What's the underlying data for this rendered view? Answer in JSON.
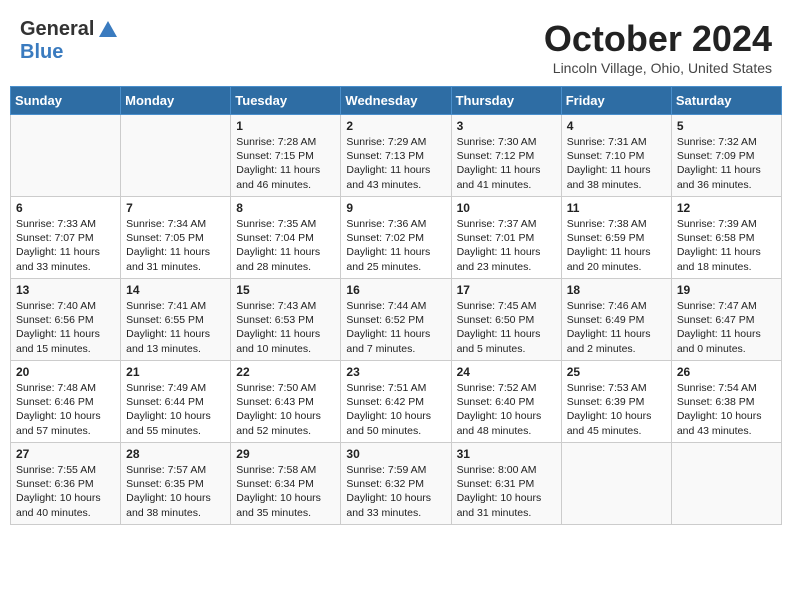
{
  "header": {
    "logo_line1": "General",
    "logo_line2": "Blue",
    "month": "October 2024",
    "location": "Lincoln Village, Ohio, United States"
  },
  "weekdays": [
    "Sunday",
    "Monday",
    "Tuesday",
    "Wednesday",
    "Thursday",
    "Friday",
    "Saturday"
  ],
  "weeks": [
    [
      {
        "day": "",
        "text": ""
      },
      {
        "day": "",
        "text": ""
      },
      {
        "day": "1",
        "text": "Sunrise: 7:28 AM\nSunset: 7:15 PM\nDaylight: 11 hours\nand 46 minutes."
      },
      {
        "day": "2",
        "text": "Sunrise: 7:29 AM\nSunset: 7:13 PM\nDaylight: 11 hours\nand 43 minutes."
      },
      {
        "day": "3",
        "text": "Sunrise: 7:30 AM\nSunset: 7:12 PM\nDaylight: 11 hours\nand 41 minutes."
      },
      {
        "day": "4",
        "text": "Sunrise: 7:31 AM\nSunset: 7:10 PM\nDaylight: 11 hours\nand 38 minutes."
      },
      {
        "day": "5",
        "text": "Sunrise: 7:32 AM\nSunset: 7:09 PM\nDaylight: 11 hours\nand 36 minutes."
      }
    ],
    [
      {
        "day": "6",
        "text": "Sunrise: 7:33 AM\nSunset: 7:07 PM\nDaylight: 11 hours\nand 33 minutes."
      },
      {
        "day": "7",
        "text": "Sunrise: 7:34 AM\nSunset: 7:05 PM\nDaylight: 11 hours\nand 31 minutes."
      },
      {
        "day": "8",
        "text": "Sunrise: 7:35 AM\nSunset: 7:04 PM\nDaylight: 11 hours\nand 28 minutes."
      },
      {
        "day": "9",
        "text": "Sunrise: 7:36 AM\nSunset: 7:02 PM\nDaylight: 11 hours\nand 25 minutes."
      },
      {
        "day": "10",
        "text": "Sunrise: 7:37 AM\nSunset: 7:01 PM\nDaylight: 11 hours\nand 23 minutes."
      },
      {
        "day": "11",
        "text": "Sunrise: 7:38 AM\nSunset: 6:59 PM\nDaylight: 11 hours\nand 20 minutes."
      },
      {
        "day": "12",
        "text": "Sunrise: 7:39 AM\nSunset: 6:58 PM\nDaylight: 11 hours\nand 18 minutes."
      }
    ],
    [
      {
        "day": "13",
        "text": "Sunrise: 7:40 AM\nSunset: 6:56 PM\nDaylight: 11 hours\nand 15 minutes."
      },
      {
        "day": "14",
        "text": "Sunrise: 7:41 AM\nSunset: 6:55 PM\nDaylight: 11 hours\nand 13 minutes."
      },
      {
        "day": "15",
        "text": "Sunrise: 7:43 AM\nSunset: 6:53 PM\nDaylight: 11 hours\nand 10 minutes."
      },
      {
        "day": "16",
        "text": "Sunrise: 7:44 AM\nSunset: 6:52 PM\nDaylight: 11 hours\nand 7 minutes."
      },
      {
        "day": "17",
        "text": "Sunrise: 7:45 AM\nSunset: 6:50 PM\nDaylight: 11 hours\nand 5 minutes."
      },
      {
        "day": "18",
        "text": "Sunrise: 7:46 AM\nSunset: 6:49 PM\nDaylight: 11 hours\nand 2 minutes."
      },
      {
        "day": "19",
        "text": "Sunrise: 7:47 AM\nSunset: 6:47 PM\nDaylight: 11 hours\nand 0 minutes."
      }
    ],
    [
      {
        "day": "20",
        "text": "Sunrise: 7:48 AM\nSunset: 6:46 PM\nDaylight: 10 hours\nand 57 minutes."
      },
      {
        "day": "21",
        "text": "Sunrise: 7:49 AM\nSunset: 6:44 PM\nDaylight: 10 hours\nand 55 minutes."
      },
      {
        "day": "22",
        "text": "Sunrise: 7:50 AM\nSunset: 6:43 PM\nDaylight: 10 hours\nand 52 minutes."
      },
      {
        "day": "23",
        "text": "Sunrise: 7:51 AM\nSunset: 6:42 PM\nDaylight: 10 hours\nand 50 minutes."
      },
      {
        "day": "24",
        "text": "Sunrise: 7:52 AM\nSunset: 6:40 PM\nDaylight: 10 hours\nand 48 minutes."
      },
      {
        "day": "25",
        "text": "Sunrise: 7:53 AM\nSunset: 6:39 PM\nDaylight: 10 hours\nand 45 minutes."
      },
      {
        "day": "26",
        "text": "Sunrise: 7:54 AM\nSunset: 6:38 PM\nDaylight: 10 hours\nand 43 minutes."
      }
    ],
    [
      {
        "day": "27",
        "text": "Sunrise: 7:55 AM\nSunset: 6:36 PM\nDaylight: 10 hours\nand 40 minutes."
      },
      {
        "day": "28",
        "text": "Sunrise: 7:57 AM\nSunset: 6:35 PM\nDaylight: 10 hours\nand 38 minutes."
      },
      {
        "day": "29",
        "text": "Sunrise: 7:58 AM\nSunset: 6:34 PM\nDaylight: 10 hours\nand 35 minutes."
      },
      {
        "day": "30",
        "text": "Sunrise: 7:59 AM\nSunset: 6:32 PM\nDaylight: 10 hours\nand 33 minutes."
      },
      {
        "day": "31",
        "text": "Sunrise: 8:00 AM\nSunset: 6:31 PM\nDaylight: 10 hours\nand 31 minutes."
      },
      {
        "day": "",
        "text": ""
      },
      {
        "day": "",
        "text": ""
      }
    ]
  ]
}
